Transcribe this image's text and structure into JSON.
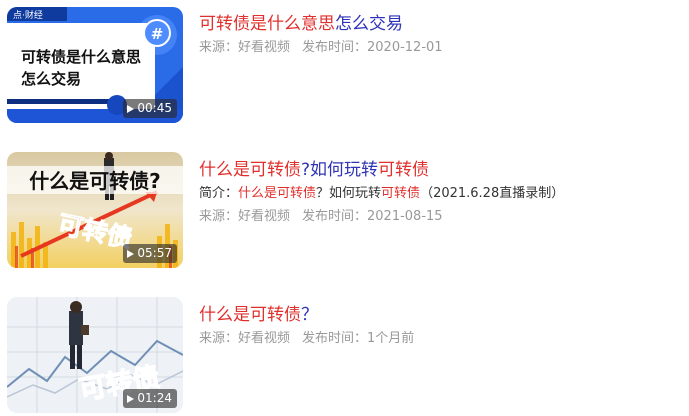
{
  "results": [
    {
      "title_parts": [
        {
          "text": "可转债是什么意思",
          "hl": true
        },
        {
          "text": "怎么交易",
          "hl": false
        }
      ],
      "thumb": {
        "overlay_text_line1": "可转债是什么意思",
        "overlay_text_line2": "怎么交易",
        "top_tag": "点·财经",
        "hash": "#",
        "duration": "00:45"
      },
      "source": "来源：好看视频",
      "publish": "发布时间：2020-12-01"
    },
    {
      "title_parts": [
        {
          "text": "什么是可转债",
          "hl": true
        },
        {
          "text": "?如何玩转",
          "hl": false
        },
        {
          "text": "可转债",
          "hl": true
        }
      ],
      "summary_parts": [
        {
          "text": "简介：",
          "hl": false
        },
        {
          "text": "什么是可转债",
          "hl": true
        },
        {
          "text": "？如何玩转",
          "hl": false
        },
        {
          "text": "可转债",
          "hl": true
        },
        {
          "text": "（2021.6.28直播录制）",
          "hl": false
        }
      ],
      "thumb": {
        "overlay_top": "什么是可转债?",
        "overlay_big": "可转债",
        "duration": "05:57"
      },
      "source": "来源：好看视频",
      "publish": "发布时间：2021-08-15"
    },
    {
      "title_parts": [
        {
          "text": "什么是可转债",
          "hl": true
        },
        {
          "text": "？",
          "hl": false
        }
      ],
      "thumb": {
        "overlay_big": "可转债",
        "duration": "01:24"
      },
      "source": "来源：好看视频",
      "publish": "发布时间：1个月前"
    }
  ],
  "colors": {
    "title_link": "#2e33b8",
    "highlight": "#e0302d",
    "meta": "#999999"
  },
  "icons": {
    "duration_play": "play-icon"
  }
}
